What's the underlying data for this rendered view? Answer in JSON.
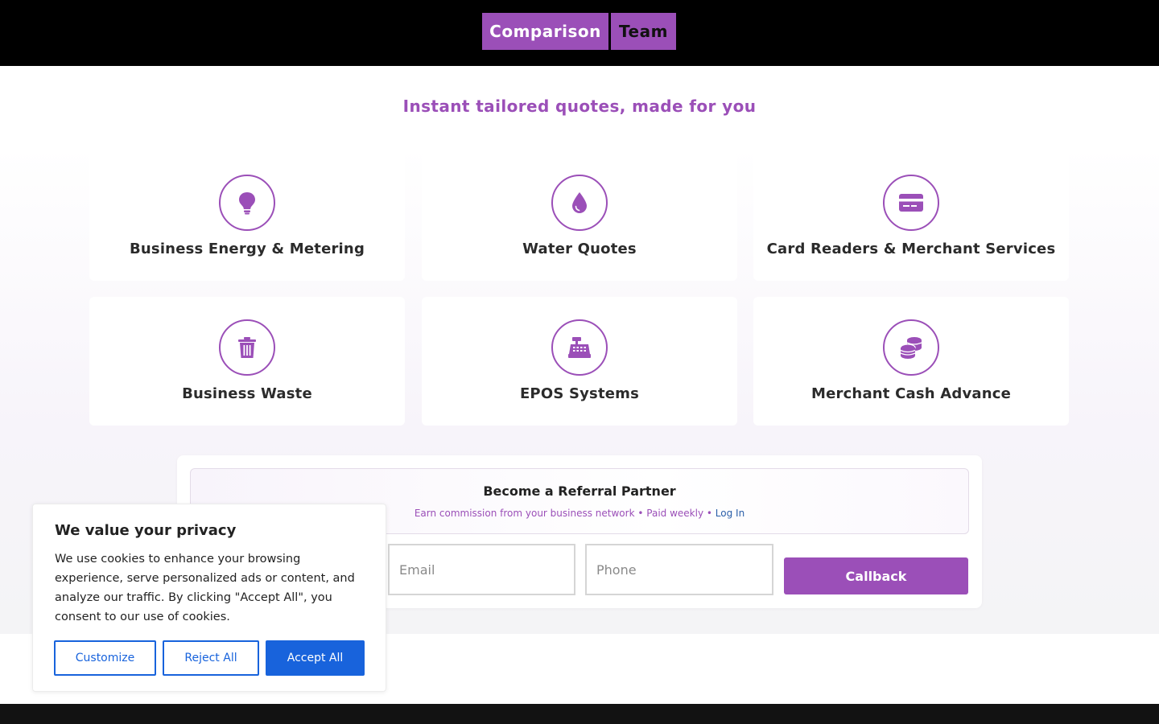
{
  "header": {
    "logo_left": "Comparison",
    "logo_right": "Team"
  },
  "main": {
    "headline": "Instant tailored quotes, made for you",
    "services": [
      {
        "label": "Business Energy & Metering",
        "icon": "lightbulb-icon"
      },
      {
        "label": "Water Quotes",
        "icon": "water-drop-icon"
      },
      {
        "label": "Card Readers & Merchant Services",
        "icon": "credit-card-icon"
      },
      {
        "label": "Business Waste",
        "icon": "trash-bin-icon"
      },
      {
        "label": "EPOS Systems",
        "icon": "cash-register-icon"
      },
      {
        "label": "Merchant Cash Advance",
        "icon": "coins-icon"
      }
    ]
  },
  "referral": {
    "title": "Become a Referral Partner",
    "subtitle": "Earn commission from your business network",
    "separator": "•",
    "paid": "Paid weekly",
    "login_label": "Log In"
  },
  "callback_form": {
    "email_placeholder": "Email",
    "phone_placeholder": "Phone",
    "button_label": "Callback"
  },
  "cookie_banner": {
    "title": "We value your privacy",
    "text": "We use cookies to enhance your browsing experience, serve personalized ads or content, and analyze our traffic. By clicking \"Accept All\", you consent to our use of cookies.",
    "customize_label": "Customize",
    "reject_label": "Reject All",
    "accept_label": "Accept All"
  },
  "colors": {
    "brand_purple": "#9b4fb8",
    "cookie_blue": "#1863dc",
    "header_bg": "#000000",
    "footer_bg": "#121212"
  }
}
